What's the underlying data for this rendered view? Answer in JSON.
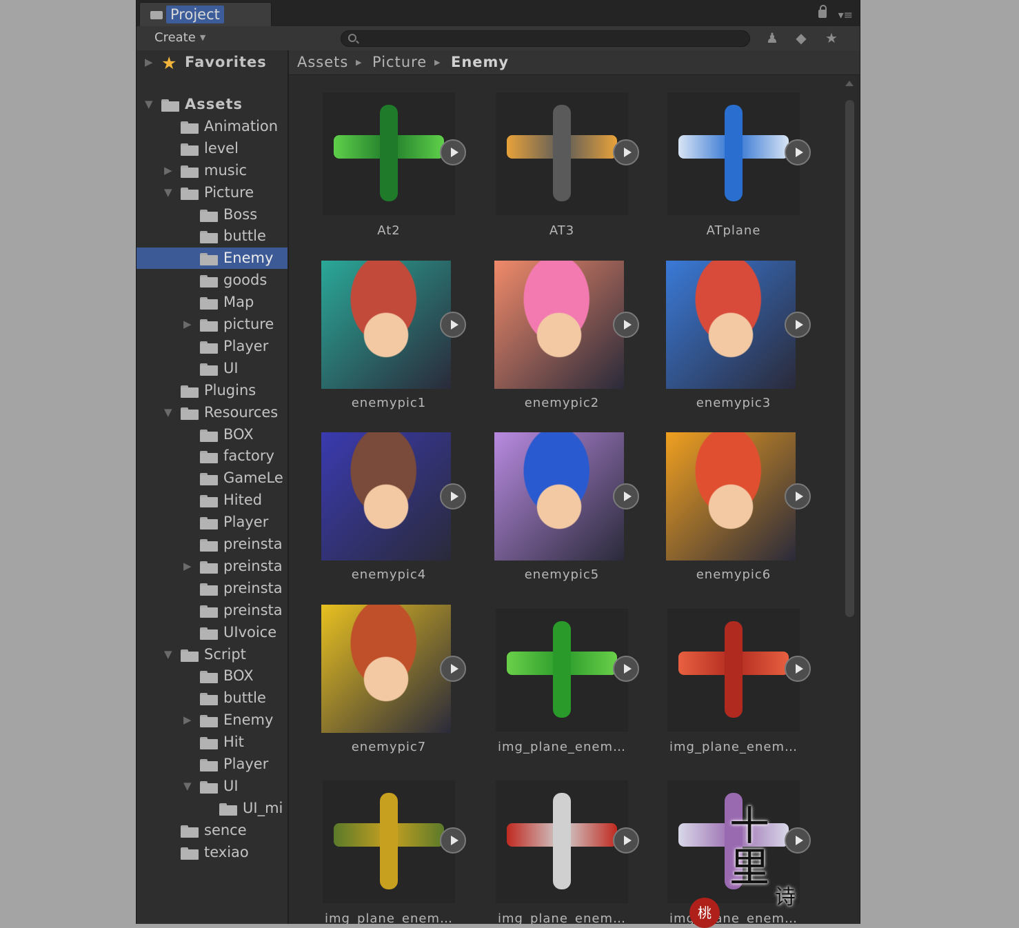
{
  "window": {
    "tab_label": "Project",
    "create_label": "Create",
    "search": {
      "value": "",
      "placeholder": ""
    }
  },
  "sidebar": {
    "favorites_label": "Favorites",
    "tree": [
      {
        "label": "Assets",
        "arrow": "down",
        "bold": true
      },
      {
        "label": "Animation",
        "arrow": ""
      },
      {
        "label": "level",
        "arrow": ""
      },
      {
        "label": "music",
        "arrow": "right"
      },
      {
        "label": "Picture",
        "arrow": "down"
      },
      {
        "label": "Boss",
        "arrow": ""
      },
      {
        "label": "buttle",
        "arrow": ""
      },
      {
        "label": "Enemy",
        "arrow": "",
        "selected": true
      },
      {
        "label": "goods",
        "arrow": ""
      },
      {
        "label": "Map",
        "arrow": ""
      },
      {
        "label": "picture",
        "arrow": "right"
      },
      {
        "label": "Player",
        "arrow": ""
      },
      {
        "label": "UI",
        "arrow": ""
      },
      {
        "label": "Plugins",
        "arrow": ""
      },
      {
        "label": "Resources",
        "arrow": "down"
      },
      {
        "label": "BOX",
        "arrow": ""
      },
      {
        "label": "factory",
        "arrow": ""
      },
      {
        "label": "GameLe",
        "arrow": ""
      },
      {
        "label": "Hited",
        "arrow": ""
      },
      {
        "label": "Player",
        "arrow": ""
      },
      {
        "label": "preinsta",
        "arrow": ""
      },
      {
        "label": "preinsta",
        "arrow": "right"
      },
      {
        "label": "preinsta",
        "arrow": ""
      },
      {
        "label": "preinsta",
        "arrow": ""
      },
      {
        "label": "UIvoice",
        "arrow": ""
      },
      {
        "label": "Script",
        "arrow": "down"
      },
      {
        "label": "BOX",
        "arrow": ""
      },
      {
        "label": "buttle",
        "arrow": ""
      },
      {
        "label": "Enemy",
        "arrow": "right"
      },
      {
        "label": "Hit",
        "arrow": ""
      },
      {
        "label": "Player",
        "arrow": ""
      },
      {
        "label": "UI",
        "arrow": "down"
      },
      {
        "label": "UI_mi",
        "arrow": ""
      },
      {
        "label": "sence",
        "arrow": ""
      },
      {
        "label": "texiao",
        "arrow": ""
      }
    ]
  },
  "breadcrumb": [
    "Assets",
    "Picture",
    "Enemy"
  ],
  "assets": [
    {
      "label": "At2",
      "kind": "ship",
      "icon": "green-fighter-ship",
      "colors": [
        "#1f7a2a",
        "#5fd04a"
      ]
    },
    {
      "label": "AT3",
      "kind": "ship",
      "icon": "grey-mech-ship",
      "colors": [
        "#5a5a5a",
        "#e8a23a"
      ]
    },
    {
      "label": "ATplane",
      "kind": "ship",
      "icon": "blue-jet-ship",
      "colors": [
        "#2a6fd0",
        "#d8e4f4"
      ]
    },
    {
      "label": "enemypic1",
      "kind": "portrait",
      "icon": "dark-haired-boy-portrait",
      "colors": [
        "#2aa898",
        "#c24a3a"
      ]
    },
    {
      "label": "enemypic2",
      "kind": "portrait",
      "icon": "pink-haired-girl-portrait",
      "colors": [
        "#f08a6a",
        "#f27ab0"
      ]
    },
    {
      "label": "enemypic3",
      "kind": "portrait",
      "icon": "white-haired-girl-portrait",
      "colors": [
        "#3a7ad8",
        "#d84a3a"
      ]
    },
    {
      "label": "enemypic4",
      "kind": "portrait",
      "icon": "goggles-warrior-portrait",
      "colors": [
        "#3a3ab0",
        "#7a4a3a"
      ]
    },
    {
      "label": "enemypic5",
      "kind": "portrait",
      "icon": "blue-haired-man-portrait",
      "colors": [
        "#b88ae0",
        "#2a5ad0"
      ]
    },
    {
      "label": "enemypic6",
      "kind": "portrait",
      "icon": "red-haired-woman-portrait",
      "colors": [
        "#f0a020",
        "#e05030"
      ]
    },
    {
      "label": "enemypic7",
      "kind": "portrait",
      "icon": "bearded-dwarf-portrait",
      "colors": [
        "#e8c020",
        "#c0502a"
      ]
    },
    {
      "label": "img_plane_enem…",
      "kind": "ship",
      "icon": "green-bomber-plane",
      "colors": [
        "#2a9a2a",
        "#6ad04a"
      ]
    },
    {
      "label": "img_plane_enem…",
      "kind": "ship",
      "icon": "red-bomber-plane",
      "colors": [
        "#b02a20",
        "#e86040"
      ]
    },
    {
      "label": "img_plane_enem…",
      "kind": "ship",
      "icon": "yellow-biplane",
      "colors": [
        "#c8a020",
        "#5a7a2a"
      ]
    },
    {
      "label": "img_plane_enem…",
      "kind": "ship",
      "icon": "white-red-plane",
      "colors": [
        "#d0d0d0",
        "#c02a20"
      ]
    },
    {
      "label": "img_plane_enem…",
      "kind": "ship",
      "icon": "purple-plane",
      "colors": [
        "#9a6ab0",
        "#d8d8e8"
      ]
    }
  ],
  "watermark": {
    "text_big": "十里",
    "text_side": "诗",
    "seal": "桃"
  }
}
